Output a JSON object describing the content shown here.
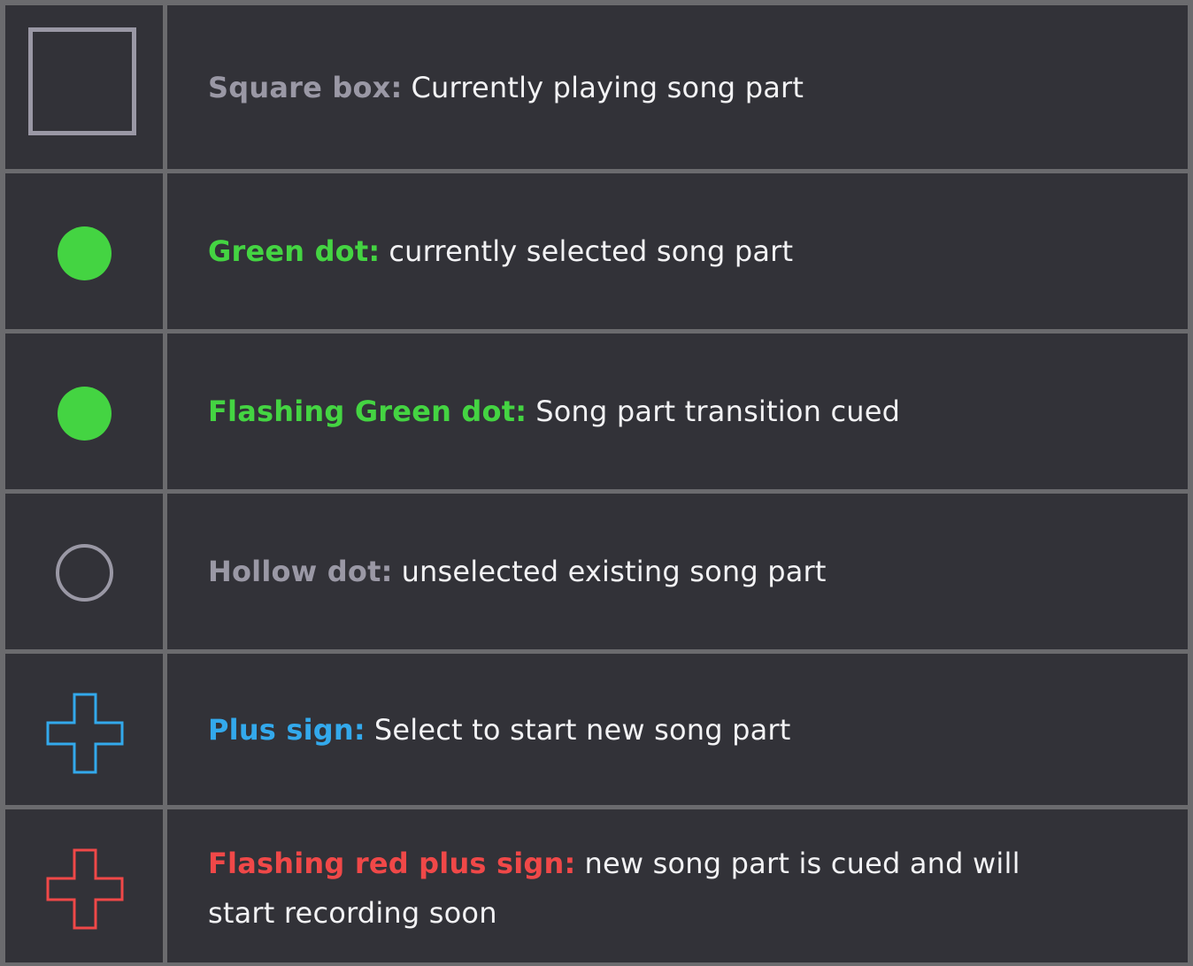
{
  "colors": {
    "background": "#323238",
    "grid": "#6b6b6e",
    "gray": "#9a98a5",
    "green": "#44d442",
    "blue": "#33a9ec",
    "red": "#f04848",
    "text": "#f2f2f4"
  },
  "rows": [
    {
      "icon": "square-box-icon",
      "label": "Square box:",
      "label_color": "#9a98a5",
      "description": "Currently playing song part"
    },
    {
      "icon": "green-dot-icon",
      "label": "Green dot:",
      "label_color": "#44d442",
      "description": "currently selected song part"
    },
    {
      "icon": "green-dot-icon",
      "label": "Flashing Green dot:",
      "label_color": "#44d442",
      "description": "Song part transition cued"
    },
    {
      "icon": "hollow-dot-icon",
      "label": "Hollow dot:",
      "label_color": "#9a98a5",
      "description": "unselected existing song part"
    },
    {
      "icon": "blue-plus-icon",
      "label": "Plus sign:",
      "label_color": "#33a9ec",
      "description": "Select to start new song part"
    },
    {
      "icon": "red-plus-icon",
      "label": "Flashing red plus sign:",
      "label_color": "#f04848",
      "description": "new song part is cued and will start recording soon"
    }
  ]
}
